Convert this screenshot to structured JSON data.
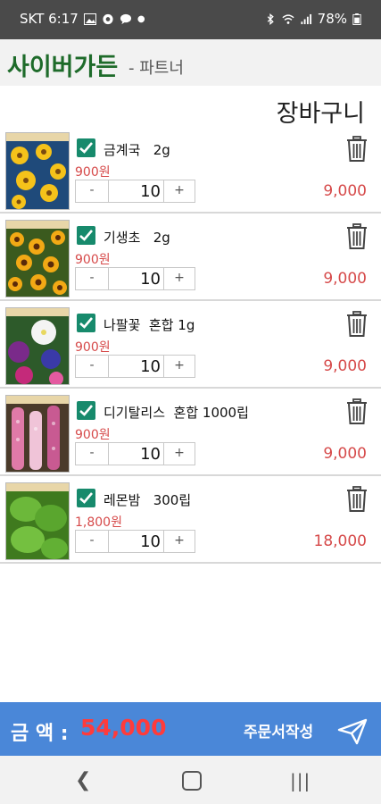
{
  "status": {
    "carrier_time": "SKT 6:17",
    "battery": "78%"
  },
  "app": {
    "title": "사이버가든",
    "subtitle": "- 파트너"
  },
  "page": {
    "title": "장바구니"
  },
  "cart": {
    "items": [
      {
        "name": "금계국   2g",
        "price": "900원",
        "qty": "10",
        "total": "9,000",
        "minus": "-",
        "plus": "+",
        "checked": true
      },
      {
        "name": "기생초   2g",
        "price": "900원",
        "qty": "10",
        "total": "9,000",
        "minus": "-",
        "plus": "+",
        "checked": true
      },
      {
        "name": "나팔꽃  혼합 1g",
        "price": "900원",
        "qty": "10",
        "total": "9,000",
        "minus": "-",
        "plus": "+",
        "checked": true
      },
      {
        "name": "디기탈리스  혼합 1000립",
        "price": "900원",
        "qty": "10",
        "total": "9,000",
        "minus": "-",
        "plus": "+",
        "checked": true
      },
      {
        "name": "레몬밤   300립",
        "price": "1,800원",
        "qty": "10",
        "total": "18,000",
        "minus": "-",
        "plus": "+",
        "checked": true
      }
    ]
  },
  "footer": {
    "amount_label": "금 액 :",
    "amount_value": "54,000",
    "order_label": "주문서작성"
  },
  "colors": {
    "brand_green": "#1e6b2a",
    "accent_blue": "#4a87d8",
    "price_red": "#d64a4a",
    "check_teal": "#178a6c"
  },
  "icons": [
    "image-icon",
    "settings-icon",
    "chat-icon",
    "bluetooth-icon",
    "wifi-icon",
    "signal-icon",
    "battery-icon",
    "checkbox-checked-icon",
    "trash-icon",
    "send-icon",
    "back-icon",
    "home-icon",
    "recents-icon"
  ]
}
